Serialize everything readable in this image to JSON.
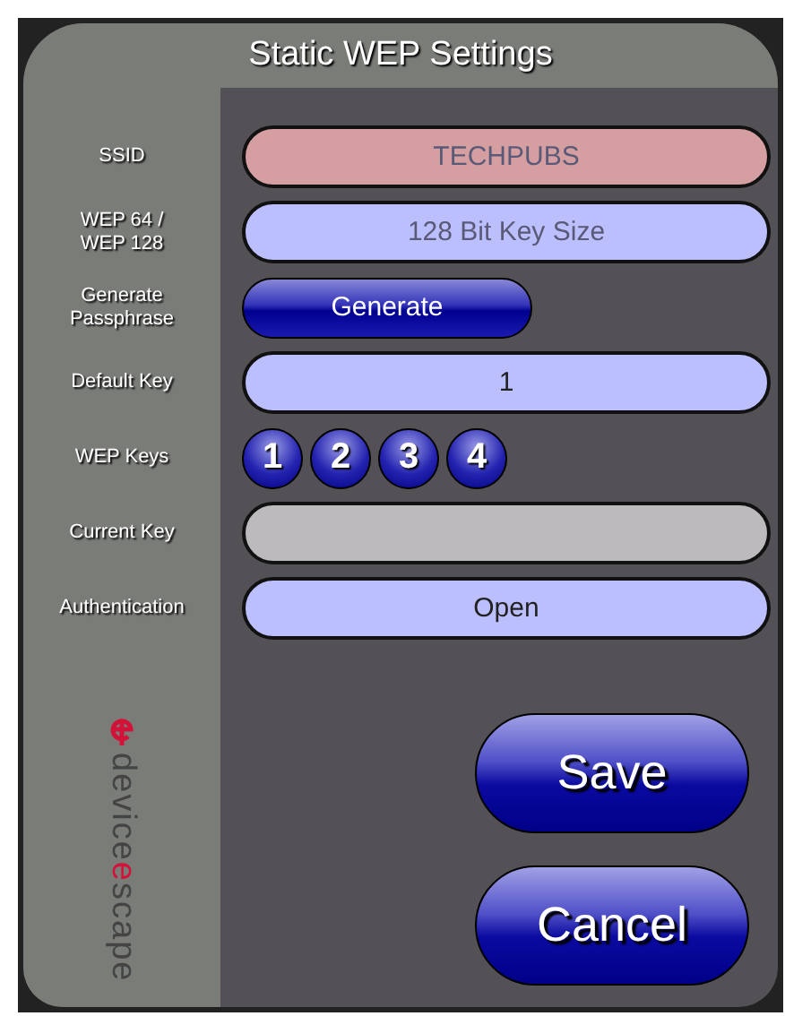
{
  "window": {
    "title": "Static WEP Settings"
  },
  "rows": [
    {
      "kind": "field",
      "label": "SSID",
      "placeholder": "TECHPUBS",
      "color": "#d59fa2"
    },
    {
      "kind": "field",
      "label": "WEP 64 / WEP 128",
      "placeholder": "128 Bit Key Size",
      "color": "#bcbffe"
    },
    {
      "kind": "button",
      "label": "Generate Passphrase",
      "value": "Generate"
    },
    {
      "kind": "select",
      "label": "Default Key",
      "value": "1",
      "color": "#bcbffe"
    },
    {
      "kind": "keys",
      "label": "WEP Keys",
      "keys": [
        "1",
        "2",
        "3",
        "4"
      ]
    },
    {
      "kind": "field",
      "label": "Current Key",
      "color": "#bcbabc"
    },
    {
      "kind": "select",
      "label": "Authentication",
      "value": "Open",
      "color": "#bcbffe"
    }
  ],
  "logo": {
    "before": "device",
    "accent": "e",
    "after": "scape"
  },
  "buttons": [
    "Save",
    "Cancel"
  ]
}
